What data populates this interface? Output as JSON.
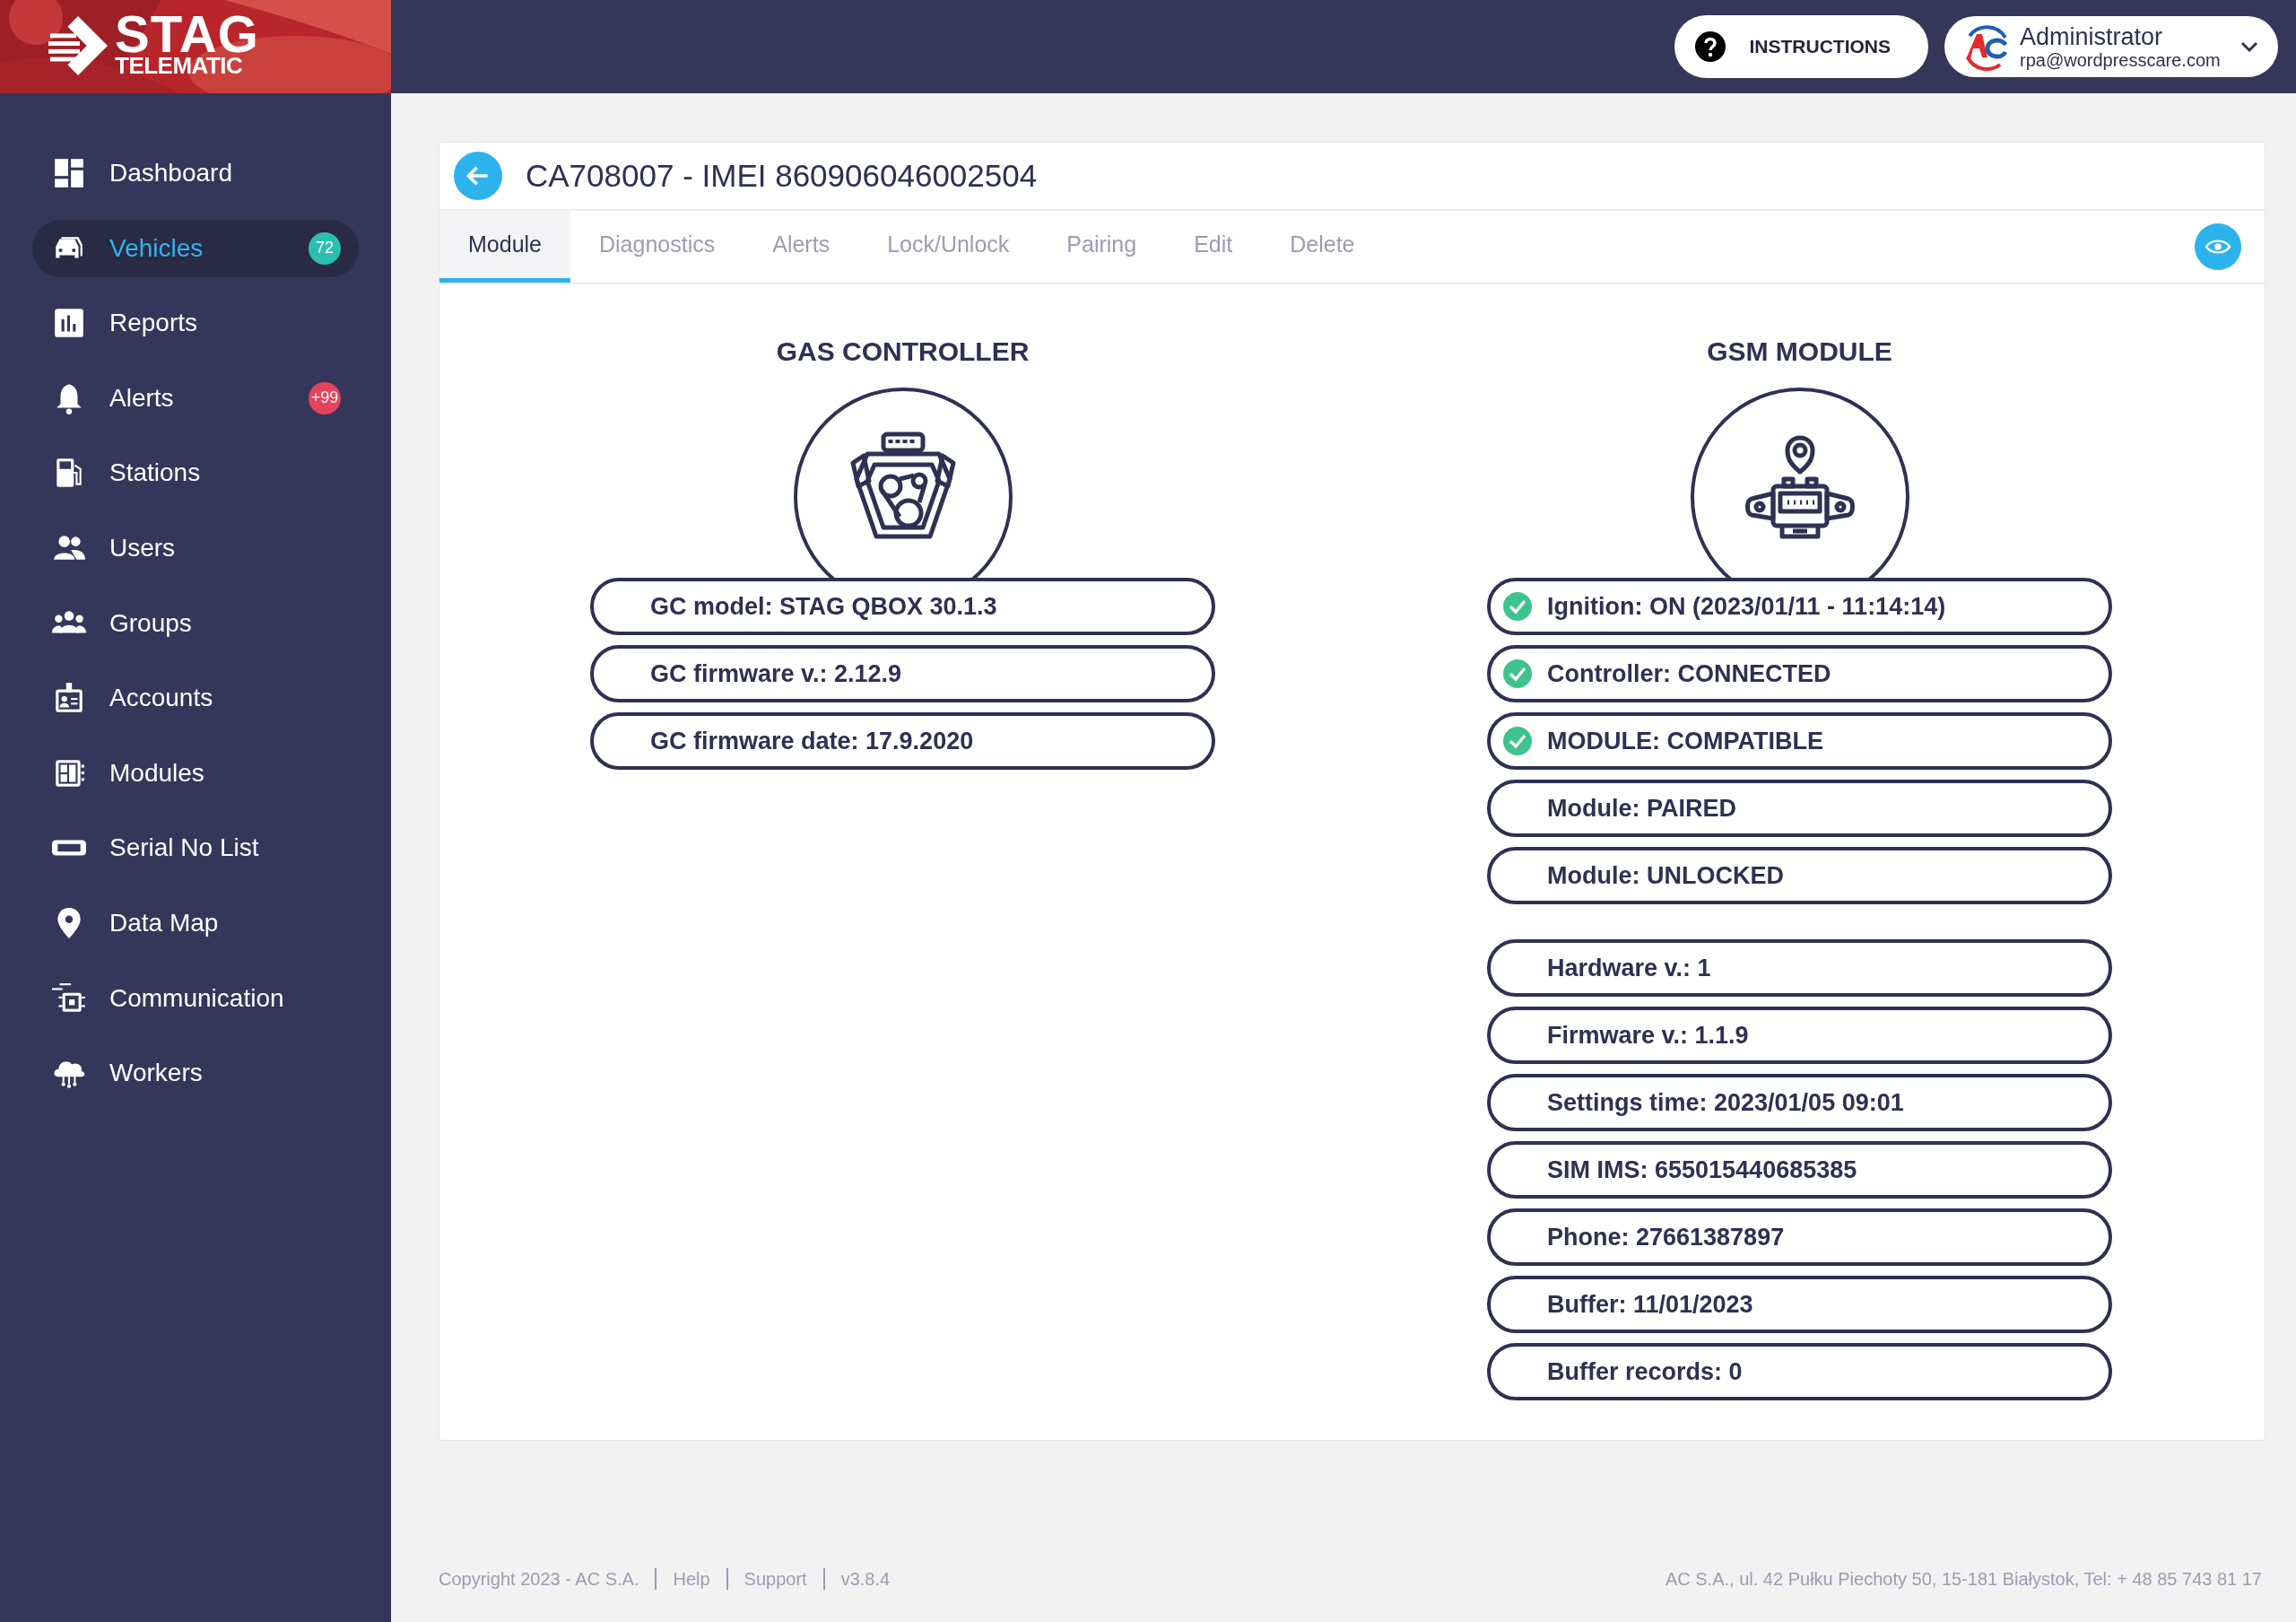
{
  "logo": {
    "line_1": "STAG",
    "line_2": "TELEMATIC"
  },
  "sidebar": {
    "items": [
      {
        "label": "Dashboard",
        "kind": "dashboard",
        "selected": false
      },
      {
        "label": "Vehicles",
        "kind": "vehicles",
        "selected": true,
        "badge": {
          "text": "72",
          "color": "#2cbfb0"
        }
      },
      {
        "label": "Reports",
        "kind": "reports",
        "selected": false
      },
      {
        "label": "Alerts",
        "kind": "alerts",
        "selected": false,
        "badge": {
          "text": "+99",
          "color": "#e5435a"
        }
      },
      {
        "label": "Stations",
        "kind": "stations",
        "selected": false
      },
      {
        "label": "Users",
        "kind": "users",
        "selected": false
      },
      {
        "label": "Groups",
        "kind": "groups",
        "selected": false
      },
      {
        "label": "Accounts",
        "kind": "accounts",
        "selected": false
      },
      {
        "label": "Modules",
        "kind": "modules",
        "selected": false
      },
      {
        "label": "Serial No List",
        "kind": "imei",
        "selected": false
      },
      {
        "label": "Data Map",
        "kind": "pin",
        "selected": false
      },
      {
        "label": "Communication",
        "kind": "chip",
        "selected": false
      },
      {
        "label": "Workers",
        "kind": "cloud",
        "selected": false
      }
    ]
  },
  "header": {
    "instructions_button": "INSTRUCTIONS",
    "user": {
      "name": "Administrator",
      "email": "rpa@wordpresscare.com"
    }
  },
  "page": {
    "title": "CA708007 - IMEI 860906046002504",
    "tabs": [
      {
        "label": "Module",
        "selected": true
      },
      {
        "label": "Diagnostics",
        "selected": false
      },
      {
        "label": "Alerts",
        "selected": false
      },
      {
        "label": "Lock/Unlock",
        "selected": false
      },
      {
        "label": "Pairing",
        "selected": false
      },
      {
        "label": "Edit",
        "selected": false
      },
      {
        "label": "Delete",
        "selected": false
      }
    ],
    "gas_controller": {
      "heading": "GAS CONTROLLER",
      "rows": [
        {
          "text": "GC model: STAG QBOX 30.1.3",
          "ok": false
        },
        {
          "text": "GC firmware v.: 2.12.9",
          "ok": false
        },
        {
          "text": "GC firmware date: 17.9.2020",
          "ok": false
        }
      ]
    },
    "gsm_module": {
      "heading": "GSM MODULE",
      "status_rows": [
        {
          "text": "Ignition: ON (2023/01/11 - 11:14:14)",
          "ok": true
        },
        {
          "text": "Controller: CONNECTED",
          "ok": true
        },
        {
          "text": "MODULE: COMPATIBLE",
          "ok": true
        },
        {
          "text": "Module: PAIRED",
          "ok": false
        },
        {
          "text": "Module: UNLOCKED",
          "ok": false
        }
      ],
      "info_rows": [
        {
          "text": "Hardware v.: 1",
          "ok": false
        },
        {
          "text": "Firmware v.: 1.1.9",
          "ok": false
        },
        {
          "text": "Settings time: 2023/01/05 09:01",
          "ok": false
        },
        {
          "text": "SIM IMS: 655015440685385",
          "ok": false
        },
        {
          "text": "Phone: 27661387897",
          "ok": false
        },
        {
          "text": "Buffer: 11/01/2023",
          "ok": false
        },
        {
          "text": "Buffer records: 0",
          "ok": false
        }
      ]
    }
  },
  "footer": {
    "links": [
      "Copyright 2023 - AC S.A.",
      "Help",
      "Support",
      "v3.8.4"
    ],
    "address": "AC S.A., ul. 42 Pułku Piechoty 50, 15-181 Białystok, Tel: + 48 85 743 81 17"
  }
}
